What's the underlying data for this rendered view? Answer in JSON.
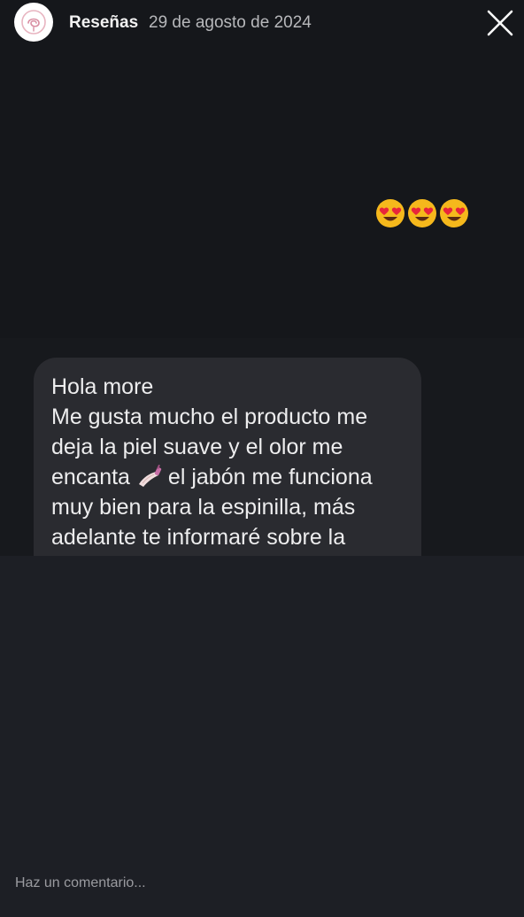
{
  "header": {
    "account_name": "Reseñas",
    "date": "29 de agosto de 2024",
    "avatar_icon": "rose-logo-icon",
    "close_icon": "close-icon"
  },
  "story": {
    "emojis": [
      "😍",
      "😍",
      "😍"
    ],
    "message": {
      "text_before_icon": "Hola more\nMe gusta mucho el producto me deja la piel suave y el olor me encanta ",
      "icon": "nail-polish-icon",
      "text_after_icon": "el jabón me funciona muy bien para la espinilla, más adelante te informaré sobre la"
    }
  },
  "comment": {
    "placeholder": "Haz un comentario..."
  },
  "colors": {
    "background": "#15171b",
    "bubble": "#2a2b30",
    "panel": "#1d1f25",
    "emoji": "#f5b81c",
    "heart": "#e8243b"
  }
}
